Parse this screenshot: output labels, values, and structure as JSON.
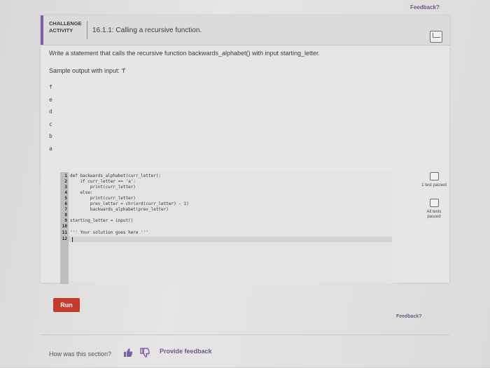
{
  "top_feedback": "Feedback?",
  "header": {
    "activity_label": "CHALLENGE ACTIVITY",
    "title": "16.1.1: Calling a recursive function."
  },
  "prompt": "Write a statement that calls the recursive function backwards_alphabet() with input starting_letter.",
  "sample_label": "Sample output with input: 'f'",
  "sample_output": [
    "f",
    "e",
    "d",
    "c",
    "b",
    "a"
  ],
  "code_lines": [
    {
      "n": "1",
      "text": "def backwards_alphabet(curr_letter):"
    },
    {
      "n": "2",
      "text": "    if curr_letter == 'a':"
    },
    {
      "n": "3",
      "text": "        print(curr_letter)"
    },
    {
      "n": "4",
      "text": "    else:"
    },
    {
      "n": "5",
      "text": "        print(curr_letter)"
    },
    {
      "n": "6",
      "text": "        prev_letter = chr(ord(curr_letter) - 1)"
    },
    {
      "n": "7",
      "text": "        backwards_alphabet(prev_letter)"
    },
    {
      "n": "8",
      "text": ""
    },
    {
      "n": "9",
      "text": "starting_letter = input()"
    },
    {
      "n": "10",
      "text": ""
    },
    {
      "n": "11",
      "text": "''' Your solution goes here '''"
    },
    {
      "n": "12",
      "text": ""
    }
  ],
  "tests": {
    "first_label": "1 test passed",
    "all_label": "All tests passed"
  },
  "run_label": "Run",
  "mid_feedback": "Feedback?",
  "footer": {
    "question": "How was this section?",
    "provide_feedback": "Provide feedback"
  }
}
